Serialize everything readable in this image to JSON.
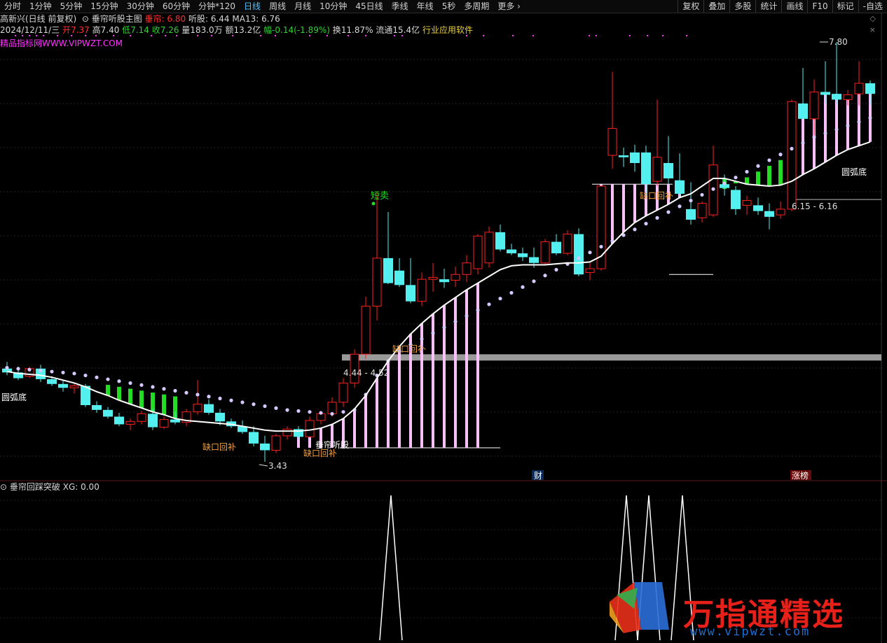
{
  "toolbar": {
    "periods": [
      "分时",
      "1分钟",
      "5分钟",
      "15分钟",
      "30分钟",
      "60分钟",
      "分钟*120",
      "日线",
      "周线",
      "月线",
      "10分钟",
      "45日线",
      "季线",
      "年线",
      "5秒",
      "多周期",
      "更多"
    ],
    "active": "日线",
    "right": [
      "复权",
      "叠加",
      "多股",
      "统计",
      "画线",
      "F10",
      "标记",
      "-自选"
    ]
  },
  "header": {
    "stock": "高新兴(日线 前复权)",
    "indicator": "垂帘听股主图",
    "chuilian_label": "垂帘",
    "chuilian_value": "6.80",
    "tinggu_label": "听股",
    "tinggu_value": "6.44",
    "ma_label": "MA13",
    "ma_value": "6.76",
    "date": "2024/12/11/三",
    "open_label": "开",
    "open": "7.37",
    "high_label": "高",
    "high": "7.40",
    "low_label": "低",
    "low": "7.14",
    "close_label": "收",
    "close": "7.26",
    "volume_label": "量",
    "volume": "183.0万",
    "amount_label": "额",
    "amount": "13.2亿",
    "change_label": "幅",
    "change": "-0.14(-1.89%)",
    "turnover_label": "换",
    "turnover": "11.87%",
    "float_label": "流通",
    "float": "15.4亿",
    "industry": "行业应用软件",
    "site": "精品指标网WWW.VIPWZT.COM"
  },
  "indicator_panel": {
    "title": "垂帘回踩突破",
    "xg_label": "XG",
    "xg_value": "0.00"
  },
  "watermark": {
    "text": "万指通精选",
    "url": "www.vipwzt.com"
  },
  "colors": {
    "up": "#ff2020",
    "down": "#54f0f0",
    "ma": "#ffffff",
    "dots": "#d8c8ff",
    "pink": "#ffc0ff",
    "green": "#22dd22",
    "zone": "#9a9a9a",
    "label_yellow": "#f0a040",
    "signal": "#ffffff"
  },
  "chart_data": {
    "type": "candlestick",
    "price_range": [
      3.43,
      7.8
    ],
    "candles": [
      [
        4.4,
        4.47,
        4.33,
        4.36
      ],
      [
        4.36,
        4.42,
        4.28,
        4.3
      ],
      [
        4.32,
        4.42,
        4.3,
        4.4
      ],
      [
        4.4,
        4.44,
        4.26,
        4.29
      ],
      [
        4.29,
        4.32,
        4.22,
        4.24
      ],
      [
        4.24,
        4.28,
        4.16,
        4.2
      ],
      [
        4.2,
        4.24,
        4.14,
        4.22
      ],
      [
        4.22,
        4.24,
        4.0,
        4.02
      ],
      [
        4.02,
        4.06,
        3.94,
        3.97
      ],
      [
        3.97,
        4.0,
        3.88,
        3.9
      ],
      [
        3.9,
        3.94,
        3.8,
        3.82
      ],
      [
        3.82,
        3.88,
        3.76,
        3.85
      ],
      [
        3.85,
        3.96,
        3.82,
        3.93
      ],
      [
        3.93,
        3.98,
        3.76,
        3.79
      ],
      [
        3.79,
        3.9,
        3.77,
        3.87
      ],
      [
        3.87,
        3.95,
        3.82,
        3.84
      ],
      [
        3.84,
        3.98,
        3.8,
        3.95
      ],
      [
        3.95,
        4.28,
        3.92,
        4.03
      ],
      [
        4.03,
        4.08,
        3.92,
        3.94
      ],
      [
        3.94,
        3.98,
        3.81,
        3.85
      ],
      [
        3.85,
        3.88,
        3.78,
        3.8
      ],
      [
        3.8,
        3.86,
        3.72,
        3.74
      ],
      [
        3.74,
        3.8,
        3.59,
        3.62
      ],
      [
        3.62,
        3.7,
        3.43,
        3.55
      ],
      [
        3.55,
        3.72,
        3.52,
        3.7
      ],
      [
        3.7,
        3.8,
        3.66,
        3.77
      ],
      [
        3.77,
        3.8,
        3.66,
        3.69
      ],
      [
        3.69,
        3.9,
        3.68,
        3.86
      ],
      [
        3.86,
        3.96,
        3.82,
        3.93
      ],
      [
        3.93,
        4.1,
        3.9,
        4.05
      ],
      [
        4.05,
        4.3,
        4.0,
        4.25
      ],
      [
        4.25,
        4.6,
        4.2,
        4.55
      ],
      [
        4.55,
        5.15,
        4.5,
        5.05
      ],
      [
        5.05,
        6.24,
        4.9,
        5.55
      ],
      [
        5.55,
        6.03,
        5.28,
        5.29
      ],
      [
        5.42,
        5.55,
        5.25,
        5.27
      ],
      [
        5.27,
        5.55,
        5.08,
        5.1
      ],
      [
        5.1,
        5.4,
        5.05,
        5.33
      ],
      [
        5.33,
        5.5,
        5.2,
        5.35
      ],
      [
        5.33,
        5.44,
        5.24,
        5.3
      ],
      [
        5.32,
        5.46,
        5.25,
        5.38
      ],
      [
        5.38,
        5.58,
        5.3,
        5.5
      ],
      [
        5.44,
        5.8,
        5.38,
        5.78
      ],
      [
        5.5,
        5.88,
        5.45,
        5.82
      ],
      [
        5.82,
        5.9,
        5.62,
        5.64
      ],
      [
        5.64,
        5.7,
        5.58,
        5.6
      ],
      [
        5.6,
        5.66,
        5.52,
        5.56
      ],
      [
        5.56,
        5.66,
        5.45,
        5.5
      ],
      [
        5.5,
        5.75,
        5.48,
        5.72
      ],
      [
        5.72,
        5.8,
        5.58,
        5.6
      ],
      [
        5.6,
        5.84,
        5.58,
        5.8
      ],
      [
        5.8,
        5.86,
        5.36,
        5.38
      ],
      [
        5.4,
        5.5,
        5.32,
        5.44
      ],
      [
        5.44,
        6.3,
        5.42,
        6.3
      ],
      [
        6.62,
        7.49,
        6.48,
        6.9
      ],
      [
        6.62,
        6.7,
        6.5,
        6.6
      ],
      [
        6.65,
        6.73,
        6.45,
        6.54
      ],
      [
        6.65,
        6.72,
        6.2,
        6.32
      ],
      [
        6.35,
        7.2,
        6.3,
        6.6
      ],
      [
        6.54,
        6.82,
        6.32,
        6.38
      ],
      [
        6.36,
        6.64,
        6.18,
        6.22
      ],
      [
        6.06,
        6.34,
        5.9,
        5.95
      ],
      [
        5.97,
        6.14,
        5.92,
        6.12
      ],
      [
        6.0,
        6.72,
        5.98,
        6.52
      ],
      [
        6.32,
        6.42,
        6.2,
        6.28
      ],
      [
        6.26,
        6.3,
        6.0,
        6.06
      ],
      [
        6.1,
        6.2,
        6.0,
        6.15
      ],
      [
        6.1,
        6.18,
        6.0,
        6.04
      ],
      [
        6.04,
        6.12,
        5.85,
        5.98
      ],
      [
        6.0,
        6.14,
        5.96,
        6.06
      ],
      [
        6.06,
        7.2,
        6.04,
        7.18
      ],
      [
        7.16,
        7.53,
        7.0,
        7.0
      ],
      [
        7.0,
        7.41,
        6.8,
        7.28
      ],
      [
        7.28,
        7.6,
        7.16,
        7.25
      ],
      [
        7.26,
        7.8,
        7.15,
        7.2
      ],
      [
        7.2,
        7.3,
        7.14,
        7.25
      ],
      [
        7.26,
        7.6,
        7.14,
        7.37
      ],
      [
        7.37,
        7.4,
        7.14,
        7.26
      ]
    ],
    "chuilian_ma": [
      4.37,
      4.35,
      4.34,
      4.33,
      4.31,
      4.28,
      4.25,
      4.21,
      4.16,
      4.12,
      4.07,
      4.03,
      3.99,
      3.95,
      3.92,
      3.88,
      3.86,
      3.85,
      3.84,
      3.83,
      3.82,
      3.8,
      3.78,
      3.76,
      3.75,
      3.75,
      3.75,
      3.76,
      3.78,
      3.82,
      3.88,
      3.98,
      4.12,
      4.3,
      4.48,
      4.63,
      4.76,
      4.87,
      4.97,
      5.06,
      5.14,
      5.22,
      5.29,
      5.36,
      5.43,
      5.47,
      5.48,
      5.48,
      5.48,
      5.49,
      5.5,
      5.5,
      5.51,
      5.57,
      5.7,
      5.82,
      5.92,
      5.99,
      6.05,
      6.11,
      6.18,
      6.22,
      6.3,
      6.38,
      6.38,
      6.35,
      6.32,
      6.31,
      6.3,
      6.31,
      6.35,
      6.42,
      6.48,
      6.55,
      6.62,
      6.68,
      6.72,
      6.76
    ],
    "tinggu_dots": [
      4.38,
      4.37,
      4.36,
      4.35,
      4.34,
      4.33,
      4.32,
      4.3,
      4.28,
      4.26,
      4.24,
      4.22,
      4.2,
      4.18,
      4.16,
      4.14,
      4.12,
      4.1,
      4.08,
      4.06,
      4.04,
      4.02,
      4.0,
      3.98,
      3.96,
      3.94,
      3.93,
      3.92,
      3.91,
      3.9,
      3.92,
      3.94,
      4.1,
      4.3,
      4.45,
      4.55,
      4.62,
      4.68,
      4.74,
      4.8,
      4.86,
      4.92,
      4.98,
      5.04,
      5.1,
      5.16,
      5.22,
      5.28,
      5.34,
      5.4,
      5.46,
      5.52,
      5.58,
      5.64,
      5.7,
      5.76,
      5.82,
      5.88,
      5.94,
      6.0,
      6.06,
      6.12,
      6.18,
      6.24,
      6.3,
      6.36,
      6.42,
      6.48,
      6.54,
      6.6,
      6.66,
      6.72,
      6.78,
      6.82,
      6.86,
      6.9,
      6.94,
      6.98
    ],
    "xg_peaks": [
      34,
      55,
      57,
      60
    ],
    "annotations": {
      "high": "7.80",
      "low": "3.43",
      "zone_label_1": "4.44 - 4.52",
      "zone_label_2": "6.15 - 6.16",
      "sell_signal": "短卖",
      "gap_fill": "缺口回补",
      "arc_bottom": "圆弧底",
      "tinggu_label": "垂帘听股",
      "cai_tag": "财",
      "zhangbang_tag": "涨榜"
    }
  }
}
